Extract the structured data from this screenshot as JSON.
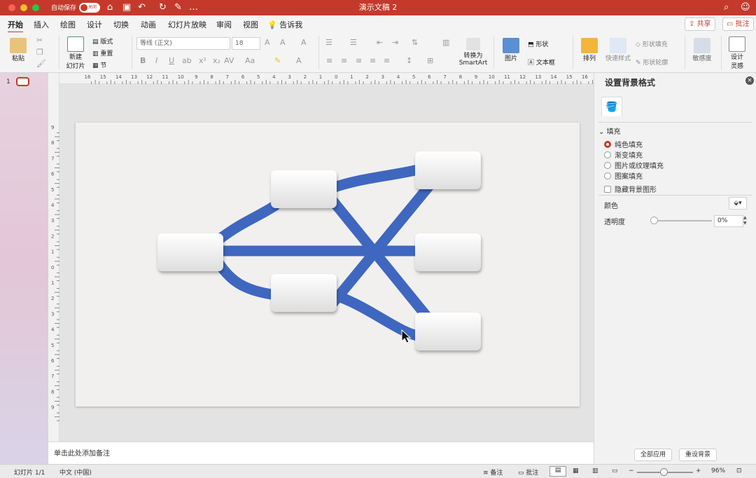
{
  "titlebar": {
    "autosave": "自动保存",
    "toggle": "关闭",
    "doc_title": "演示文稿 2"
  },
  "tabs": [
    "开始",
    "插入",
    "绘图",
    "设计",
    "切换",
    "动画",
    "幻灯片放映",
    "审阅",
    "视图",
    "告诉我"
  ],
  "actions": {
    "share": "共享",
    "comment": "批注"
  },
  "ribbon": {
    "paste": "粘贴",
    "new_slide_1": "新建",
    "new_slide_2": "幻灯片",
    "layout": "版式",
    "reset": "重置",
    "section": "节",
    "font": "等线 (正文)",
    "font_size": "18",
    "smartart_1": "转换为",
    "smartart_2": "SmartArt",
    "picture": "图片",
    "shapes": "形状",
    "textbox": "文本框",
    "arrange": "排列",
    "quick_styles": "快速样式",
    "shape_fill": "形状填充",
    "shape_outline": "形状轮廓",
    "sensitivity": "敏感度",
    "designer_1": "设计",
    "designer_2": "灵感"
  },
  "ruler": {
    "top_labels": [
      "16",
      "15",
      "14",
      "13",
      "12",
      "11",
      "10",
      "9",
      "8",
      "7",
      "6",
      "5",
      "4",
      "3",
      "2",
      "1",
      "0",
      "1",
      "2",
      "3",
      "4",
      "5",
      "6",
      "7",
      "8",
      "9",
      "10",
      "11",
      "12",
      "13",
      "14",
      "15",
      "16"
    ],
    "left_labels": [
      "9",
      "8",
      "7",
      "6",
      "5",
      "4",
      "3",
      "2",
      "1",
      "0",
      "1",
      "2",
      "3",
      "4",
      "5",
      "6",
      "7",
      "8",
      "9"
    ]
  },
  "slides": {
    "number": "1"
  },
  "notes_placeholder": "单击此处添加备注",
  "panel": {
    "title": "设置背景格式",
    "section": "填充",
    "fill_options": [
      "纯色填充",
      "渐变填充",
      "图片或纹理填充",
      "图案填充"
    ],
    "selected_fill": "纯色填充",
    "hide_bg": "隐藏背景图形",
    "color_label": "颜色",
    "transparency_label": "透明度",
    "transparency_value": "0%",
    "apply_all": "全部应用",
    "reset_bg": "重设背景"
  },
  "status": {
    "slide": "幻灯片 1/1",
    "lang": "中文 (中国)",
    "notes": "备注",
    "comments": "批注",
    "zoom": "96%"
  },
  "colors": {
    "accent": "#c4392b",
    "connector": "#3f67c0"
  }
}
